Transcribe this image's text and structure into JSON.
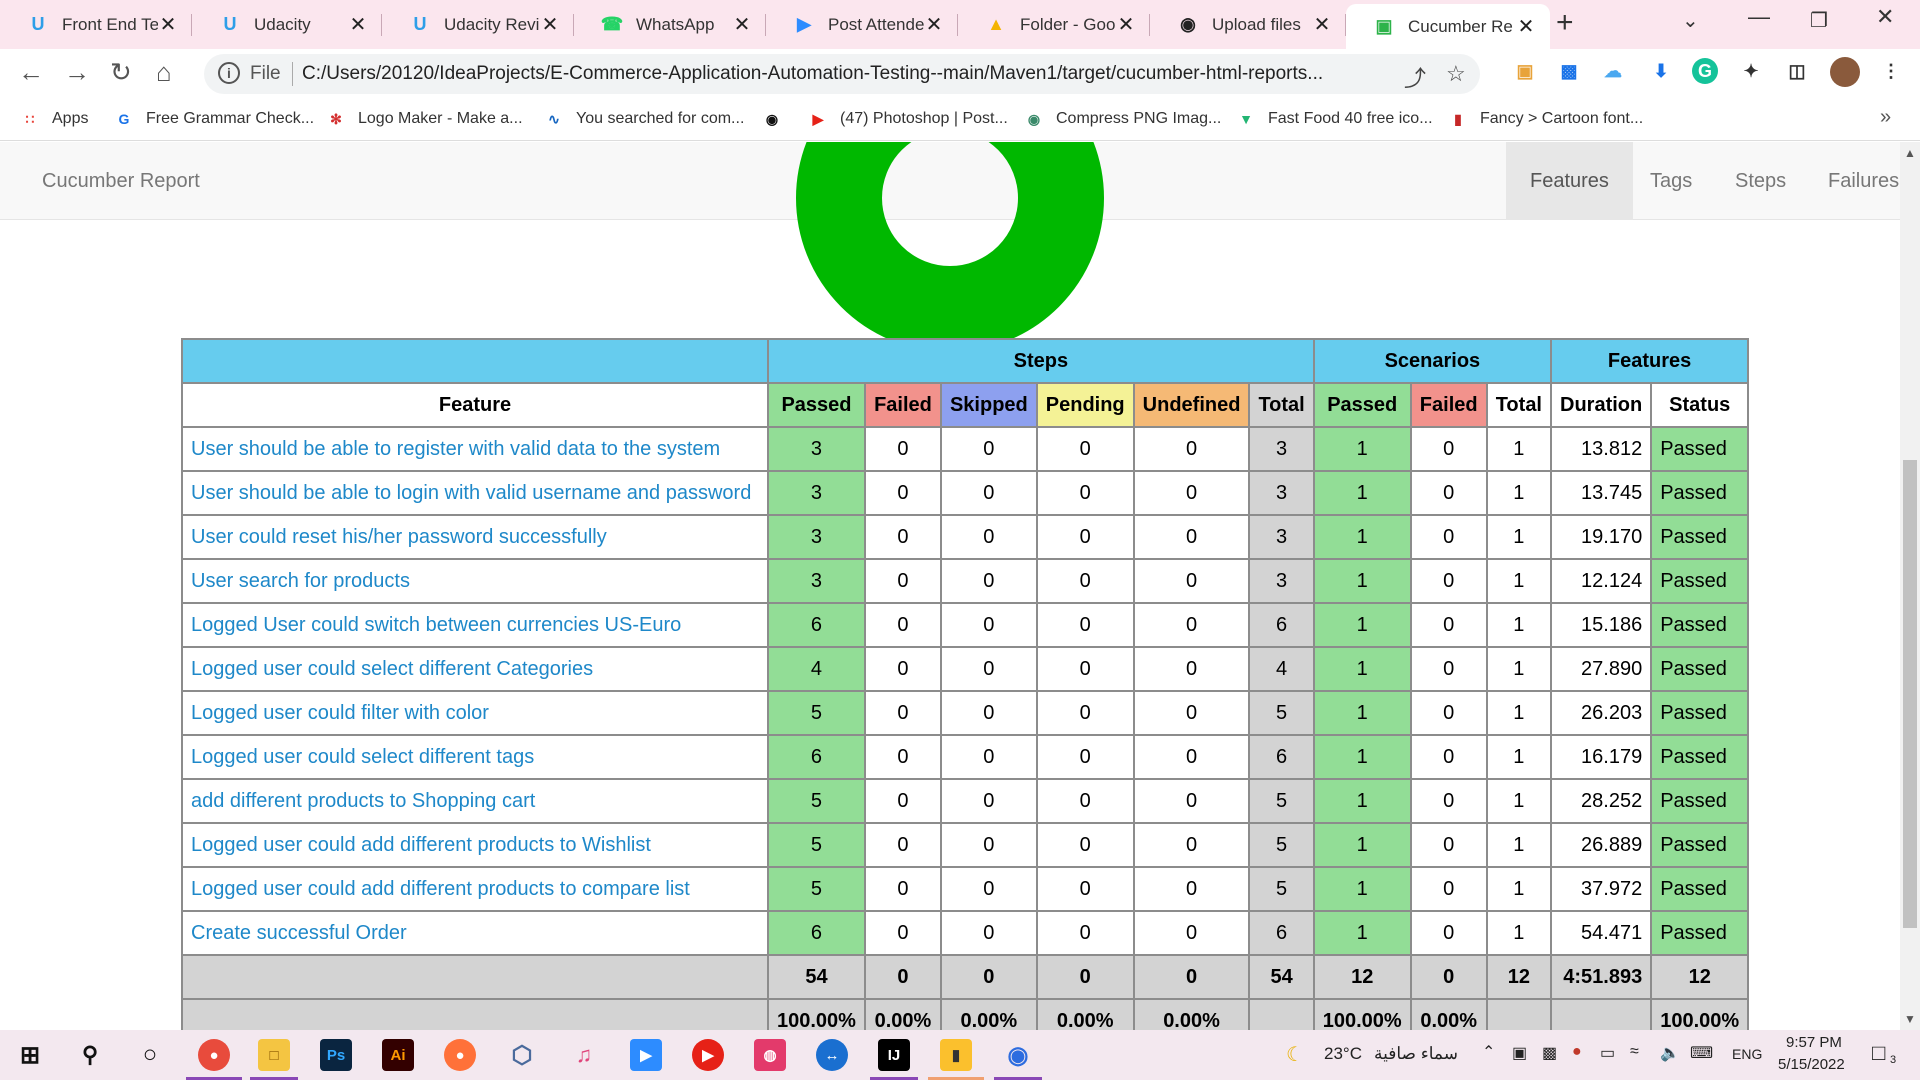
{
  "browser": {
    "tabs": [
      {
        "title": "Front End Test",
        "icon": "udacity-icon",
        "color": "#2e9ee8",
        "active": false
      },
      {
        "title": "Udacity",
        "icon": "udacity-icon",
        "color": "#2e9ee8",
        "active": false
      },
      {
        "title": "Udacity Review",
        "icon": "udacity-icon",
        "color": "#2e9ee8",
        "active": false
      },
      {
        "title": "WhatsApp",
        "icon": "whatsapp-icon",
        "color": "#25d366",
        "active": false
      },
      {
        "title": "Post Attendee",
        "icon": "zoom-icon",
        "color": "#2d8cff",
        "active": false
      },
      {
        "title": "Folder - Goog",
        "icon": "google-drive-icon",
        "color": "#f4b400",
        "active": false
      },
      {
        "title": "Upload files",
        "icon": "github-icon",
        "color": "#222222",
        "active": false
      },
      {
        "title": "Cucumber Re",
        "icon": "cucumber-icon",
        "color": "#2db34a",
        "active": true
      }
    ],
    "url_scheme": "File",
    "url": "C:/Users/20120/IdeaProjects/E-Commerce-Application-Automation-Testing--main/Maven1/target/cucumber-html-reports...",
    "bookmarks": [
      {
        "label": "Apps",
        "icon": "apps-grid-icon"
      },
      {
        "label": "Free Grammar Check...",
        "icon": "grammar-icon"
      },
      {
        "label": "Logo Maker - Make a...",
        "icon": "logo-maker-icon"
      },
      {
        "label": "You searched for com...",
        "icon": "search-site-icon"
      },
      {
        "label": "",
        "icon": "globe-icon"
      },
      {
        "label": "(47) Photoshop | Post...",
        "icon": "youtube-icon"
      },
      {
        "label": "Compress PNG Imag...",
        "icon": "panda-icon"
      },
      {
        "label": "Fast Food 40 free ico...",
        "icon": "flaticon-icon"
      },
      {
        "label": "Fancy > Cartoon font...",
        "icon": "dafont-icon"
      }
    ]
  },
  "report": {
    "brand": "Cucumber Report",
    "nav": [
      "Features",
      "Tags",
      "Steps",
      "Failures"
    ],
    "active_nav": "Features",
    "carousel_active_index": 1,
    "table": {
      "group_headers": {
        "steps": "Steps",
        "scenarios": "Scenarios",
        "features": "Features"
      },
      "columns": {
        "feature": "Feature",
        "passed": "Passed",
        "failed": "Failed",
        "skipped": "Skipped",
        "pending": "Pending",
        "undefined": "Undefined",
        "total": "Total",
        "sc_passed": "Passed",
        "sc_failed": "Failed",
        "sc_total": "Total",
        "duration": "Duration",
        "status": "Status"
      },
      "rows": [
        {
          "feature": "User should be able to register with valid data to the system",
          "passed": "3",
          "failed": "0",
          "skipped": "0",
          "pending": "0",
          "undefined": "0",
          "total": "3",
          "sc_passed": "1",
          "sc_failed": "0",
          "sc_total": "1",
          "duration": "13.812",
          "status": "Passed"
        },
        {
          "feature": "User should be able to login with valid username and password",
          "passed": "3",
          "failed": "0",
          "skipped": "0",
          "pending": "0",
          "undefined": "0",
          "total": "3",
          "sc_passed": "1",
          "sc_failed": "0",
          "sc_total": "1",
          "duration": "13.745",
          "status": "Passed"
        },
        {
          "feature": "User could reset his/her password successfully",
          "passed": "3",
          "failed": "0",
          "skipped": "0",
          "pending": "0",
          "undefined": "0",
          "total": "3",
          "sc_passed": "1",
          "sc_failed": "0",
          "sc_total": "1",
          "duration": "19.170",
          "status": "Passed"
        },
        {
          "feature": "User search for products",
          "passed": "3",
          "failed": "0",
          "skipped": "0",
          "pending": "0",
          "undefined": "0",
          "total": "3",
          "sc_passed": "1",
          "sc_failed": "0",
          "sc_total": "1",
          "duration": "12.124",
          "status": "Passed"
        },
        {
          "feature": "Logged User could switch between currencies US-Euro",
          "passed": "6",
          "failed": "0",
          "skipped": "0",
          "pending": "0",
          "undefined": "0",
          "total": "6",
          "sc_passed": "1",
          "sc_failed": "0",
          "sc_total": "1",
          "duration": "15.186",
          "status": "Passed"
        },
        {
          "feature": "Logged user could select different Categories",
          "passed": "4",
          "failed": "0",
          "skipped": "0",
          "pending": "0",
          "undefined": "0",
          "total": "4",
          "sc_passed": "1",
          "sc_failed": "0",
          "sc_total": "1",
          "duration": "27.890",
          "status": "Passed"
        },
        {
          "feature": "Logged user could filter with color",
          "passed": "5",
          "failed": "0",
          "skipped": "0",
          "pending": "0",
          "undefined": "0",
          "total": "5",
          "sc_passed": "1",
          "sc_failed": "0",
          "sc_total": "1",
          "duration": "26.203",
          "status": "Passed"
        },
        {
          "feature": "Logged user could select different tags",
          "passed": "6",
          "failed": "0",
          "skipped": "0",
          "pending": "0",
          "undefined": "0",
          "total": "6",
          "sc_passed": "1",
          "sc_failed": "0",
          "sc_total": "1",
          "duration": "16.179",
          "status": "Passed"
        },
        {
          "feature": "add different products to Shopping cart",
          "passed": "5",
          "failed": "0",
          "skipped": "0",
          "pending": "0",
          "undefined": "0",
          "total": "5",
          "sc_passed": "1",
          "sc_failed": "0",
          "sc_total": "1",
          "duration": "28.252",
          "status": "Passed"
        },
        {
          "feature": "Logged user could add different products to Wishlist",
          "passed": "5",
          "failed": "0",
          "skipped": "0",
          "pending": "0",
          "undefined": "0",
          "total": "5",
          "sc_passed": "1",
          "sc_failed": "0",
          "sc_total": "1",
          "duration": "26.889",
          "status": "Passed"
        },
        {
          "feature": "Logged user could add different products to compare list",
          "passed": "5",
          "failed": "0",
          "skipped": "0",
          "pending": "0",
          "undefined": "0",
          "total": "5",
          "sc_passed": "1",
          "sc_failed": "0",
          "sc_total": "1",
          "duration": "37.972",
          "status": "Passed"
        },
        {
          "feature": "Create successful Order",
          "passed": "6",
          "failed": "0",
          "skipped": "0",
          "pending": "0",
          "undefined": "0",
          "total": "6",
          "sc_passed": "1",
          "sc_failed": "0",
          "sc_total": "1",
          "duration": "54.471",
          "status": "Passed"
        }
      ],
      "totals": {
        "passed": "54",
        "failed": "0",
        "skipped": "0",
        "pending": "0",
        "undefined": "0",
        "total": "54",
        "sc_passed": "12",
        "sc_failed": "0",
        "sc_total": "12",
        "duration": "4:51.893",
        "status": "12"
      },
      "percentages": {
        "passed": "100.00%",
        "failed": "0.00%",
        "skipped": "0.00%",
        "pending": "0.00%",
        "undefined": "0.00%",
        "total": "",
        "sc_passed": "100.00%",
        "sc_failed": "0.00%",
        "sc_total": "",
        "duration": "",
        "status": "100.00%"
      }
    }
  },
  "taskbar": {
    "weather": "23°C",
    "weather_text": "سماء صافية",
    "language": "ENG",
    "time": "9:57 PM",
    "date": "5/15/2022",
    "notifications": "3"
  },
  "colors": {
    "header_blue": "#66ccee",
    "passed": "#92dd96",
    "failed": "#f2928c",
    "skipped": "#8da0ef",
    "pending": "#f4f296",
    "undefined": "#f5b975",
    "total": "#d3d3d3",
    "donut": "#00b800",
    "link": "#1e88c9"
  }
}
